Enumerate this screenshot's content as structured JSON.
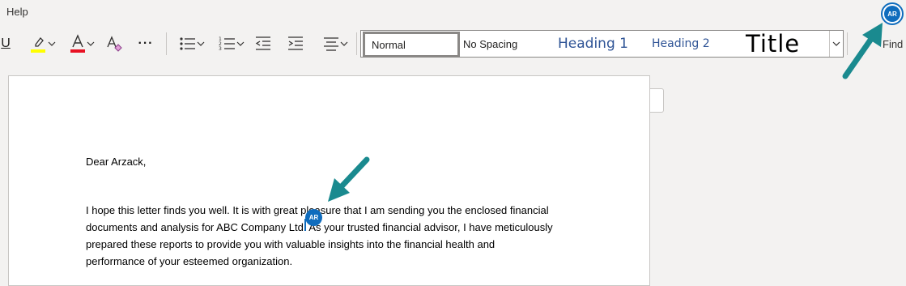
{
  "menu": {
    "help_label": "Help"
  },
  "toolbar": {
    "underline_label": "U",
    "more_label": "···",
    "find_label": "Find"
  },
  "styles": {
    "normal": "Normal",
    "no_spacing": "No Spacing",
    "heading1": "Heading 1",
    "heading2": "Heading 2",
    "title": "Title"
  },
  "user": {
    "initials": "AR",
    "accent": "#0f6cbd"
  },
  "document": {
    "greeting": "Dear Arzack,",
    "paragraph_lines": [
      "I hope this letter finds you well. It is with great pleasure that I am sending you the enclosed financial",
      "documents and analysis for ABC Company Ltd. As your trusted financial advisor, I have meticulously",
      "prepared these reports to provide you with valuable insights into the financial health and",
      "performance of your esteemed organization."
    ]
  },
  "colors": {
    "highlight": "#ffff00",
    "font_color": "#e81123",
    "annotation_arrow": "#1a8a8f"
  }
}
